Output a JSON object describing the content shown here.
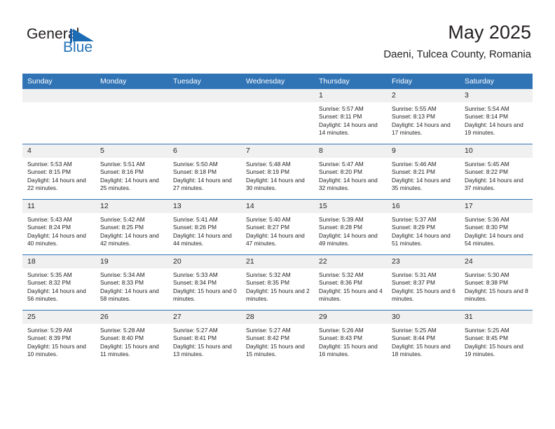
{
  "brand": {
    "name_part1": "General",
    "name_part2": "Blue",
    "logo_icon": "blue-flag-triangle-logo",
    "accent_color": "#2372b9"
  },
  "header": {
    "title": "May 2025",
    "subtitle": "Daeni, Tulcea County, Romania"
  },
  "theme": {
    "header_blue": "#3174b6",
    "daynum_gray": "#f0f0f0",
    "text_color": "#231f20"
  },
  "weekday_headers": [
    "Sunday",
    "Monday",
    "Tuesday",
    "Wednesday",
    "Thursday",
    "Friday",
    "Saturday"
  ],
  "weeks": [
    [
      {
        "day": "",
        "sunrise": "",
        "sunset": "",
        "daylight": "",
        "empty": true
      },
      {
        "day": "",
        "sunrise": "",
        "sunset": "",
        "daylight": "",
        "empty": true
      },
      {
        "day": "",
        "sunrise": "",
        "sunset": "",
        "daylight": "",
        "empty": true
      },
      {
        "day": "",
        "sunrise": "",
        "sunset": "",
        "daylight": "",
        "empty": true
      },
      {
        "day": "1",
        "sunrise": "Sunrise: 5:57 AM",
        "sunset": "Sunset: 8:11 PM",
        "daylight": "Daylight: 14 hours and 14 minutes."
      },
      {
        "day": "2",
        "sunrise": "Sunrise: 5:55 AM",
        "sunset": "Sunset: 8:13 PM",
        "daylight": "Daylight: 14 hours and 17 minutes."
      },
      {
        "day": "3",
        "sunrise": "Sunrise: 5:54 AM",
        "sunset": "Sunset: 8:14 PM",
        "daylight": "Daylight: 14 hours and 19 minutes."
      }
    ],
    [
      {
        "day": "4",
        "sunrise": "Sunrise: 5:53 AM",
        "sunset": "Sunset: 8:15 PM",
        "daylight": "Daylight: 14 hours and 22 minutes."
      },
      {
        "day": "5",
        "sunrise": "Sunrise: 5:51 AM",
        "sunset": "Sunset: 8:16 PM",
        "daylight": "Daylight: 14 hours and 25 minutes."
      },
      {
        "day": "6",
        "sunrise": "Sunrise: 5:50 AM",
        "sunset": "Sunset: 8:18 PM",
        "daylight": "Daylight: 14 hours and 27 minutes."
      },
      {
        "day": "7",
        "sunrise": "Sunrise: 5:48 AM",
        "sunset": "Sunset: 8:19 PM",
        "daylight": "Daylight: 14 hours and 30 minutes."
      },
      {
        "day": "8",
        "sunrise": "Sunrise: 5:47 AM",
        "sunset": "Sunset: 8:20 PM",
        "daylight": "Daylight: 14 hours and 32 minutes."
      },
      {
        "day": "9",
        "sunrise": "Sunrise: 5:46 AM",
        "sunset": "Sunset: 8:21 PM",
        "daylight": "Daylight: 14 hours and 35 minutes."
      },
      {
        "day": "10",
        "sunrise": "Sunrise: 5:45 AM",
        "sunset": "Sunset: 8:22 PM",
        "daylight": "Daylight: 14 hours and 37 minutes."
      }
    ],
    [
      {
        "day": "11",
        "sunrise": "Sunrise: 5:43 AM",
        "sunset": "Sunset: 8:24 PM",
        "daylight": "Daylight: 14 hours and 40 minutes."
      },
      {
        "day": "12",
        "sunrise": "Sunrise: 5:42 AM",
        "sunset": "Sunset: 8:25 PM",
        "daylight": "Daylight: 14 hours and 42 minutes."
      },
      {
        "day": "13",
        "sunrise": "Sunrise: 5:41 AM",
        "sunset": "Sunset: 8:26 PM",
        "daylight": "Daylight: 14 hours and 44 minutes."
      },
      {
        "day": "14",
        "sunrise": "Sunrise: 5:40 AM",
        "sunset": "Sunset: 8:27 PM",
        "daylight": "Daylight: 14 hours and 47 minutes."
      },
      {
        "day": "15",
        "sunrise": "Sunrise: 5:39 AM",
        "sunset": "Sunset: 8:28 PM",
        "daylight": "Daylight: 14 hours and 49 minutes."
      },
      {
        "day": "16",
        "sunrise": "Sunrise: 5:37 AM",
        "sunset": "Sunset: 8:29 PM",
        "daylight": "Daylight: 14 hours and 51 minutes."
      },
      {
        "day": "17",
        "sunrise": "Sunrise: 5:36 AM",
        "sunset": "Sunset: 8:30 PM",
        "daylight": "Daylight: 14 hours and 54 minutes."
      }
    ],
    [
      {
        "day": "18",
        "sunrise": "Sunrise: 5:35 AM",
        "sunset": "Sunset: 8:32 PM",
        "daylight": "Daylight: 14 hours and 56 minutes."
      },
      {
        "day": "19",
        "sunrise": "Sunrise: 5:34 AM",
        "sunset": "Sunset: 8:33 PM",
        "daylight": "Daylight: 14 hours and 58 minutes."
      },
      {
        "day": "20",
        "sunrise": "Sunrise: 5:33 AM",
        "sunset": "Sunset: 8:34 PM",
        "daylight": "Daylight: 15 hours and 0 minutes."
      },
      {
        "day": "21",
        "sunrise": "Sunrise: 5:32 AM",
        "sunset": "Sunset: 8:35 PM",
        "daylight": "Daylight: 15 hours and 2 minutes."
      },
      {
        "day": "22",
        "sunrise": "Sunrise: 5:32 AM",
        "sunset": "Sunset: 8:36 PM",
        "daylight": "Daylight: 15 hours and 4 minutes."
      },
      {
        "day": "23",
        "sunrise": "Sunrise: 5:31 AM",
        "sunset": "Sunset: 8:37 PM",
        "daylight": "Daylight: 15 hours and 6 minutes."
      },
      {
        "day": "24",
        "sunrise": "Sunrise: 5:30 AM",
        "sunset": "Sunset: 8:38 PM",
        "daylight": "Daylight: 15 hours and 8 minutes."
      }
    ],
    [
      {
        "day": "25",
        "sunrise": "Sunrise: 5:29 AM",
        "sunset": "Sunset: 8:39 PM",
        "daylight": "Daylight: 15 hours and 10 minutes."
      },
      {
        "day": "26",
        "sunrise": "Sunrise: 5:28 AM",
        "sunset": "Sunset: 8:40 PM",
        "daylight": "Daylight: 15 hours and 11 minutes."
      },
      {
        "day": "27",
        "sunrise": "Sunrise: 5:27 AM",
        "sunset": "Sunset: 8:41 PM",
        "daylight": "Daylight: 15 hours and 13 minutes."
      },
      {
        "day": "28",
        "sunrise": "Sunrise: 5:27 AM",
        "sunset": "Sunset: 8:42 PM",
        "daylight": "Daylight: 15 hours and 15 minutes."
      },
      {
        "day": "29",
        "sunrise": "Sunrise: 5:26 AM",
        "sunset": "Sunset: 8:43 PM",
        "daylight": "Daylight: 15 hours and 16 minutes."
      },
      {
        "day": "30",
        "sunrise": "Sunrise: 5:25 AM",
        "sunset": "Sunset: 8:44 PM",
        "daylight": "Daylight: 15 hours and 18 minutes."
      },
      {
        "day": "31",
        "sunrise": "Sunrise: 5:25 AM",
        "sunset": "Sunset: 8:45 PM",
        "daylight": "Daylight: 15 hours and 19 minutes."
      }
    ]
  ]
}
